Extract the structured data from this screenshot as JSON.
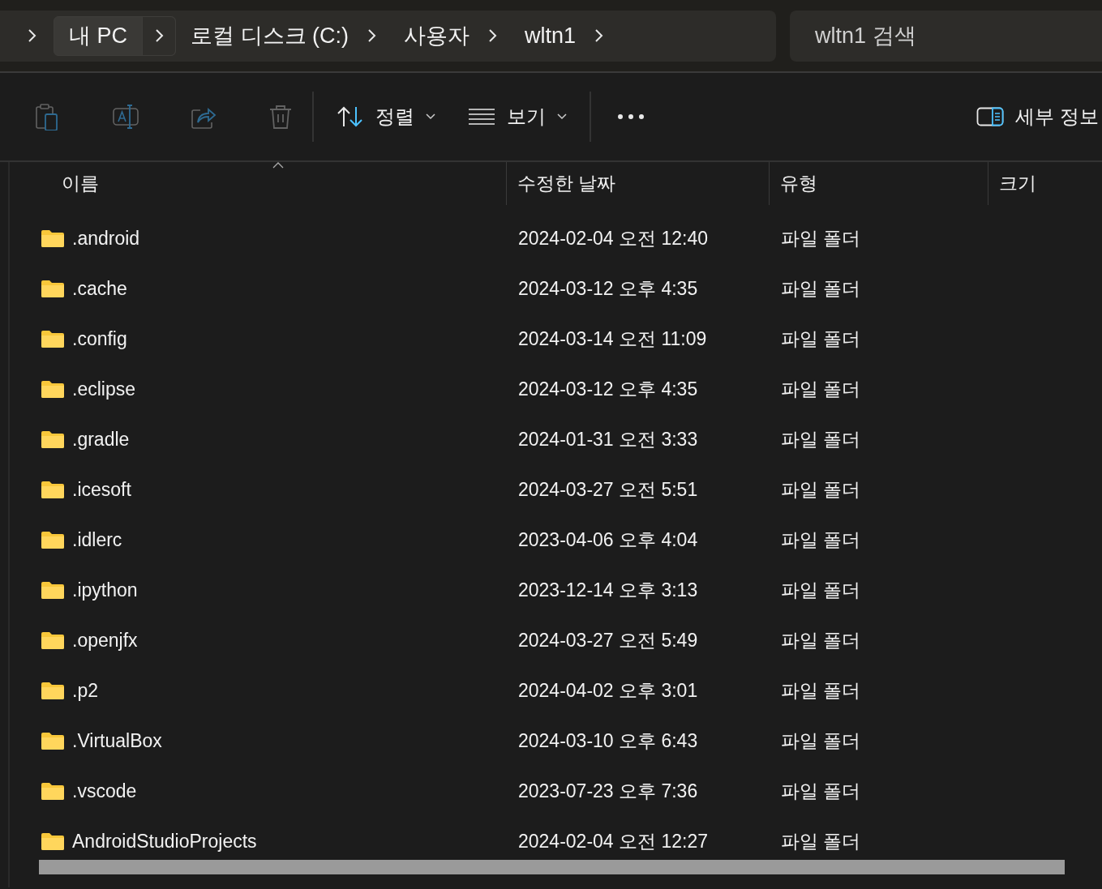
{
  "breadcrumb": [
    {
      "label": "내 PC",
      "selected": true
    },
    {
      "label": "로컬 디스크 (C:)",
      "selected": false
    },
    {
      "label": "사용자",
      "selected": false
    },
    {
      "label": "wltn1",
      "selected": false
    }
  ],
  "search": {
    "placeholder": "wltn1 검색"
  },
  "toolbar": {
    "icon_buttons": [
      {
        "kind": "paste",
        "disabled": true
      },
      {
        "kind": "rename",
        "disabled": true
      },
      {
        "kind": "share",
        "disabled": true
      },
      {
        "kind": "delete",
        "disabled": true
      }
    ],
    "sort": "정렬",
    "view": "보기",
    "details": "세부 정보"
  },
  "table": {
    "columns": [
      {
        "label": "이름",
        "sorted": true
      },
      {
        "label": "수정한 날짜",
        "sorted": false
      },
      {
        "label": "유형",
        "sorted": false
      },
      {
        "label": "크기",
        "sorted": false
      }
    ],
    "rows": [
      {
        "name": ".android",
        "modified": "2024-02-04 오전 12:40",
        "type": "파일 폴더"
      },
      {
        "name": ".cache",
        "modified": "2024-03-12 오후 4:35",
        "type": "파일 폴더"
      },
      {
        "name": ".config",
        "modified": "2024-03-14 오전 11:09",
        "type": "파일 폴더"
      },
      {
        "name": ".eclipse",
        "modified": "2024-03-12 오후 4:35",
        "type": "파일 폴더"
      },
      {
        "name": ".gradle",
        "modified": "2024-01-31 오전 3:33",
        "type": "파일 폴더"
      },
      {
        "name": ".icesoft",
        "modified": "2024-03-27 오전 5:51",
        "type": "파일 폴더"
      },
      {
        "name": ".idlerc",
        "modified": "2023-04-06 오후 4:04",
        "type": "파일 폴더"
      },
      {
        "name": ".ipython",
        "modified": "2023-12-14 오후 3:13",
        "type": "파일 폴더"
      },
      {
        "name": ".openjfx",
        "modified": "2024-03-27 오전 5:49",
        "type": "파일 폴더"
      },
      {
        "name": ".p2",
        "modified": "2024-04-02 오후 3:01",
        "type": "파일 폴더"
      },
      {
        "name": ".VirtualBox",
        "modified": "2024-03-10 오후 6:43",
        "type": "파일 폴더"
      },
      {
        "name": ".vscode",
        "modified": "2023-07-23 오후 7:36",
        "type": "파일 폴더"
      },
      {
        "name": "AndroidStudioProjects",
        "modified": "2024-02-04 오전 12:27",
        "type": "파일 폴더"
      }
    ]
  }
}
